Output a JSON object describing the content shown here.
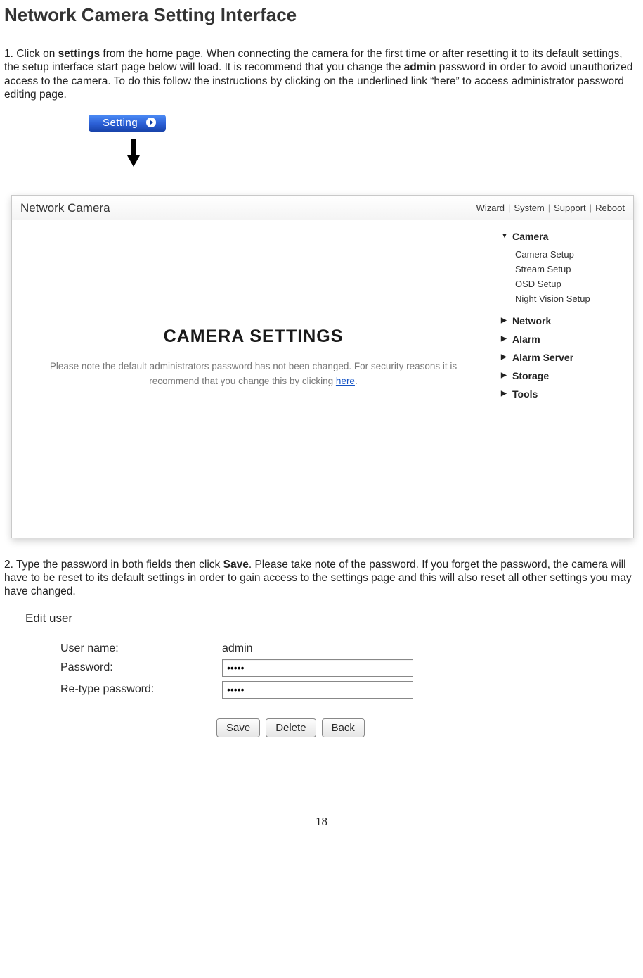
{
  "page_title": "Network Camera Setting Interface",
  "para1_a": "1. Click on ",
  "para1_b_bold": "settings",
  "para1_c": " from the home page. When connecting the camera for the first time or after resetting it to its default settings, the setup interface start page below will load. It is recommend that you change the ",
  "para1_d_bold": "admin",
  "para1_e": " password in order to avoid unauthorized access to the camera. To do this follow the instructions by clicking on the underlined link “here” to access administrator password editing page.",
  "setting_btn": "Setting",
  "shot1": {
    "title": "Network Camera",
    "nav": [
      "Wizard",
      "System",
      "Support",
      "Reboot"
    ],
    "main_title": "CAMERA SETTINGS",
    "msg_a": "Please note the default administrators password has not been changed. For security reasons it is recommend that you change this by clicking ",
    "msg_link": "here",
    "msg_b": ".",
    "side": {
      "camera": {
        "label": "Camera",
        "items": [
          "Camera Setup",
          "Stream Setup",
          "OSD Setup",
          "Night Vision Setup"
        ]
      },
      "groups": [
        "Network",
        "Alarm",
        "Alarm Server",
        "Storage",
        "Tools"
      ]
    }
  },
  "para2_a": "2. Type the password in both fields then click ",
  "para2_b_bold": "Save",
  "para2_c": ". Please take note of the password. If you forget the password, the camera will have to be reset to its default settings in order to gain access to the settings page and this will also reset all other settings you may have changed.",
  "edit_user": {
    "title": "Edit user",
    "username_label": "User name:",
    "username_value": "admin",
    "password_label": "Password:",
    "password_value": "•••••",
    "retype_label": "Re-type password:",
    "retype_value": "•••••",
    "buttons": [
      "Save",
      "Delete",
      "Back"
    ]
  },
  "page_number": "18"
}
